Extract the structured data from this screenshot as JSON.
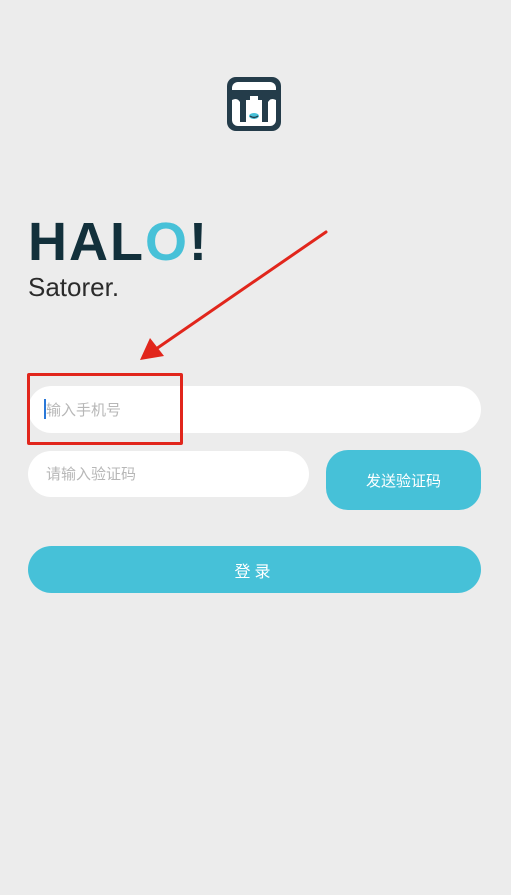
{
  "brand": {
    "logo_icon": "dog-face-logo-icon",
    "halo_prefix": "HAL",
    "halo_o": "O",
    "halo_suffix": "!",
    "subtitle": "Satorer."
  },
  "form": {
    "phone_placeholder": "输入手机号",
    "code_placeholder": "请输入验证码",
    "send_code_label": "发送验证码",
    "login_label": "登录"
  },
  "colors": {
    "background": "#ececec",
    "accent": "#46c1d8",
    "halo_dark": "#12303b",
    "annotation_red": "#e1261c"
  },
  "annotation": {
    "type": "red-arrow-and-box",
    "target": "phone-input"
  }
}
